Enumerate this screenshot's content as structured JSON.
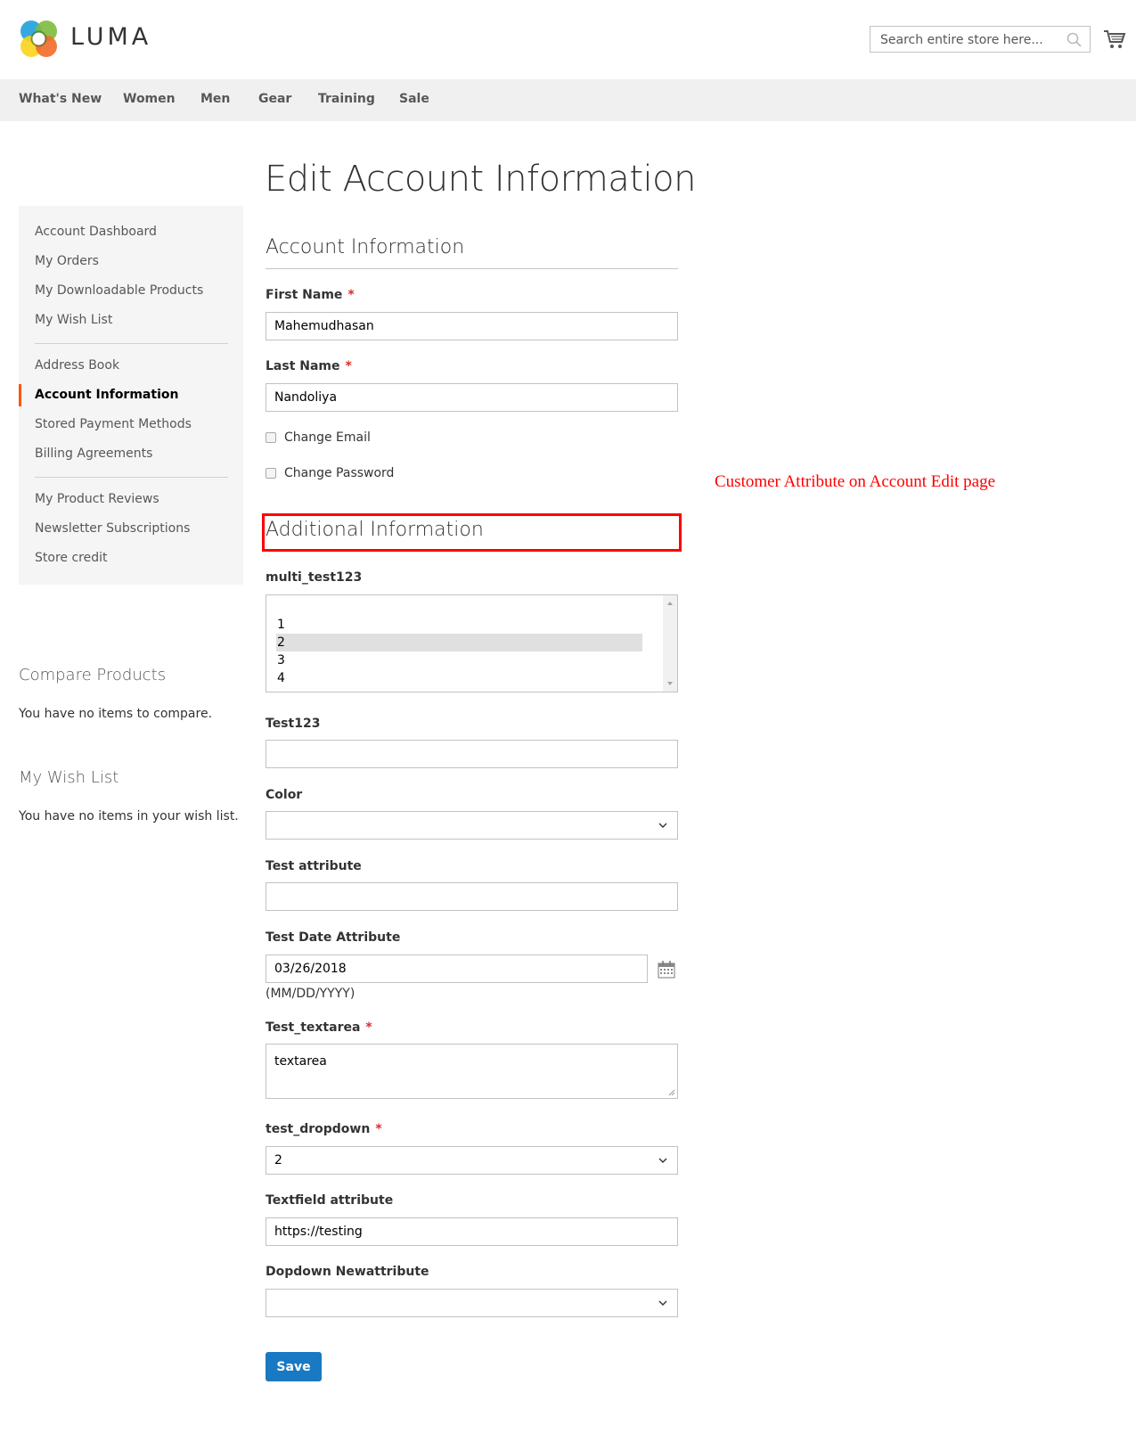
{
  "header": {
    "logo_text": "LUMA",
    "search_placeholder": "Search entire store here...",
    "icons": {
      "search": "search-icon",
      "cart": "cart-icon",
      "logo": "luma-logo-icon"
    }
  },
  "nav": {
    "items": [
      {
        "label": "What's New"
      },
      {
        "label": "Women"
      },
      {
        "label": "Men"
      },
      {
        "label": "Gear"
      },
      {
        "label": "Training"
      },
      {
        "label": "Sale"
      }
    ]
  },
  "sidebar": {
    "groups": [
      [
        {
          "label": "Account Dashboard"
        },
        {
          "label": "My Orders"
        },
        {
          "label": "My Downloadable Products"
        },
        {
          "label": "My Wish List"
        }
      ],
      [
        {
          "label": "Address Book"
        },
        {
          "label": "Account Information",
          "active": true
        },
        {
          "label": "Stored Payment Methods"
        },
        {
          "label": "Billing Agreements"
        }
      ],
      [
        {
          "label": "My Product Reviews"
        },
        {
          "label": "Newsletter Subscriptions"
        },
        {
          "label": "Store credit"
        }
      ]
    ],
    "active_color": "#ff5501",
    "compare": {
      "title": "Compare Products",
      "text": "You have no items to compare."
    },
    "wishlist": {
      "title": "My Wish List",
      "text": "You have no items in your wish list."
    }
  },
  "main": {
    "page_title": "Edit Account Information",
    "account_section": {
      "title": "Account Information",
      "first_name": {
        "label": "First Name",
        "required": "*",
        "value": "Mahemudhasan"
      },
      "last_name": {
        "label": "Last Name",
        "required": "*",
        "value": "Nandoliya"
      },
      "change_email": {
        "label": "Change Email",
        "checked": false
      },
      "change_password": {
        "label": "Change Password",
        "checked": false
      }
    },
    "additional_section": {
      "title": "Additional Information",
      "multi_test123": {
        "label": "multi_test123",
        "options": [
          "",
          "1",
          "2",
          "3",
          "4"
        ],
        "selected": "2"
      },
      "test123": {
        "label": "Test123",
        "value": ""
      },
      "color": {
        "label": "Color",
        "value": ""
      },
      "test_attribute": {
        "label": "Test attribute",
        "value": ""
      },
      "test_date": {
        "label": "Test Date Attribute",
        "value": "03/26/2018",
        "hint": "(MM/DD/YYYY)"
      },
      "test_textarea": {
        "label": "Test_textarea",
        "required": "*",
        "value": "textarea"
      },
      "test_dropdown": {
        "label": "test_dropdown",
        "required": "*",
        "value": "2"
      },
      "textfield_attribute": {
        "label": "Textfield attribute",
        "value": "https://testing"
      },
      "dropdown_newattribute": {
        "label": "Dopdown Newattribute",
        "value": ""
      }
    },
    "save_label": "Save",
    "save_color": "#1979c3"
  },
  "annotation": {
    "text": "Customer Attribute on Account Edit page",
    "color": "#ff0000"
  }
}
